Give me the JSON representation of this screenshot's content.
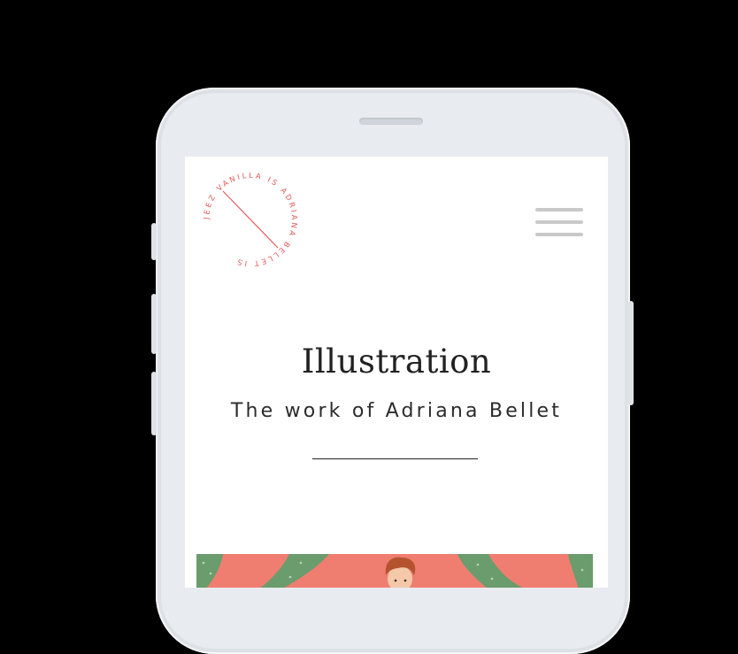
{
  "logo": {
    "ring_text": "JEEZ VANILLA IS ADRIANA BELLET IS",
    "color": "#e25a5a"
  },
  "menu": {
    "icon": "hamburger-menu-icon"
  },
  "hero": {
    "title": "Illustration",
    "subtitle": "The work of Adriana Bellet"
  },
  "artwork": {
    "description_icon": "illustration-image",
    "colors": {
      "background": "#ef7e70",
      "leaf": "#6b9c6d",
      "hair": "#b5532f"
    }
  }
}
